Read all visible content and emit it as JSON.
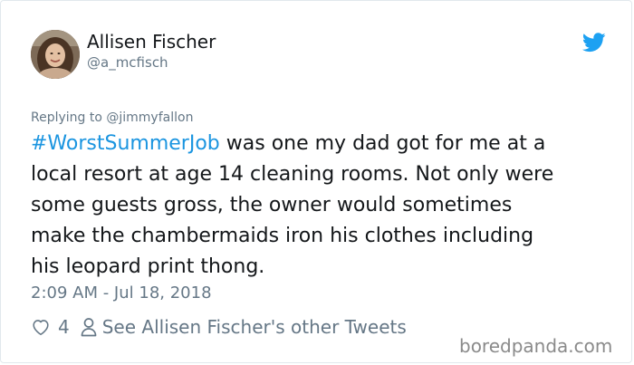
{
  "author": {
    "display_name": "Allisen Fischer",
    "handle": "@a_mcfisch"
  },
  "reply": {
    "text": "Replying to @jimmyfallon"
  },
  "tweet": {
    "hashtag": "#WorstSummerJob",
    "line1_rest": " was one my dad got for me at a",
    "line2": "local resort at age 14 cleaning rooms. Not only were",
    "line3": "some guests gross, the owner would sometimes",
    "line4": "make the chambermaids iron his clothes including",
    "line5": "his leopard print thong."
  },
  "meta": {
    "timestamp": "2:09 AM - Jul 18, 2018"
  },
  "actions": {
    "like_count": "4",
    "other_tweets_label": "See Allisen Fischer's other Tweets"
  },
  "watermark": {
    "text": "boredpanda.com"
  },
  "colors": {
    "link": "#1b95e0",
    "twitter_blue": "#1da1f2",
    "secondary_text": "#657786",
    "primary_text": "#14171a"
  },
  "icons": {
    "brand": "twitter-bird-icon",
    "like": "heart-icon",
    "profile": "person-icon"
  }
}
